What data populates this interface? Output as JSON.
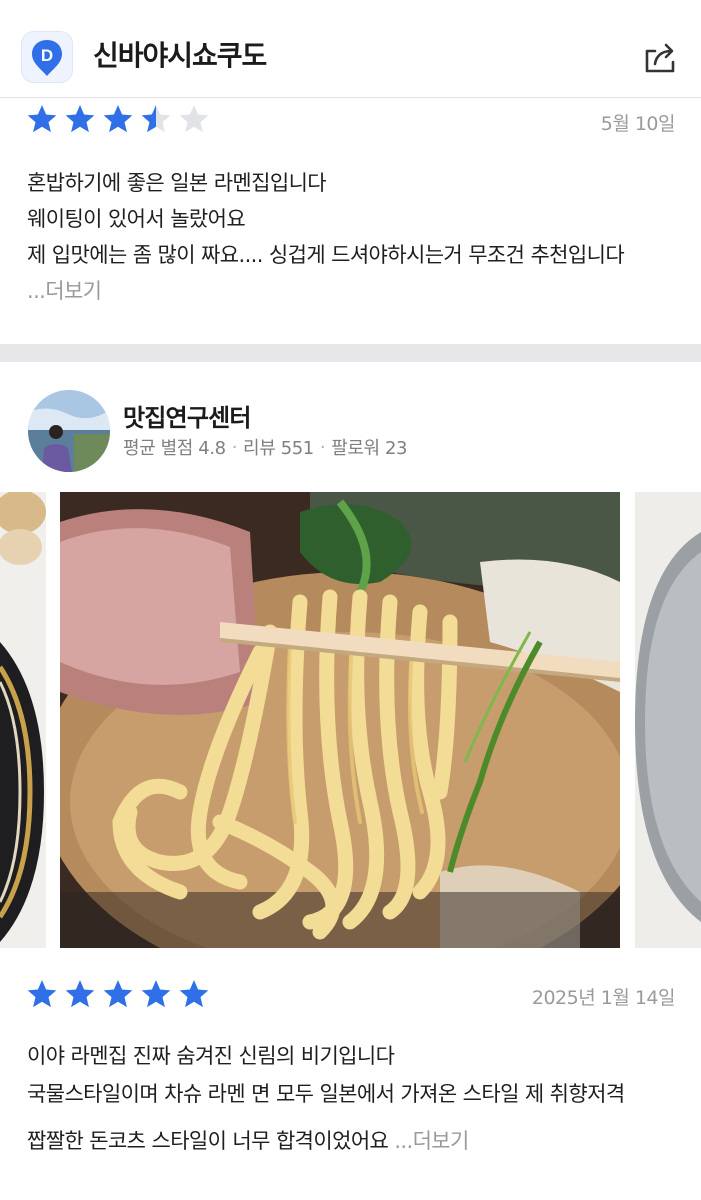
{
  "header": {
    "title": "신바야시쇼쿠도",
    "app_icon_name": "app-logo-icon",
    "share_icon_name": "share-icon"
  },
  "colors": {
    "accent": "#2f6fe8",
    "star_empty": "#e2e3e7",
    "divider": "#e7e7ea",
    "muted_text": "#9a9a9e"
  },
  "review1": {
    "rating": 3.5,
    "max_rating": 5,
    "date": "5월 10일",
    "lines": [
      "혼밥하기에 좋은 일본 라멘집입니다",
      "웨이팅이 있어서 놀랐어요",
      "제 입맛에는 좀 많이 짜요.... 싱겁게 드셔야하시는거 무조건 추천입니다"
    ],
    "more_label": "...더보기"
  },
  "review2": {
    "reviewer": {
      "name": "맛집연구센터",
      "avg_rating_label": "평균 별점 4.8",
      "review_count_label": "리뷰 551",
      "followers_label": "팔로워 23",
      "separator": "·"
    },
    "photos": [
      {
        "name": "photo-bowl-left",
        "subject": "ramen bowl (partial)"
      },
      {
        "name": "photo-noodles-main",
        "subject": "noodles lifted with chopsticks"
      },
      {
        "name": "photo-bowl-right",
        "subject": "bowl (partial)"
      }
    ],
    "rating": 5,
    "max_rating": 5,
    "date": "2025년 1월 14일",
    "lines": [
      "이야 라멘집 진짜 숨겨진 신림의 비기입니다",
      "국물스타일이며 차슈 라멘 면 모두 일본에서 가져온 스타일 제 취향저격",
      "짭짤한 돈코츠 스타일이 너무 합격이었어요"
    ],
    "more_label": "...더보기"
  }
}
